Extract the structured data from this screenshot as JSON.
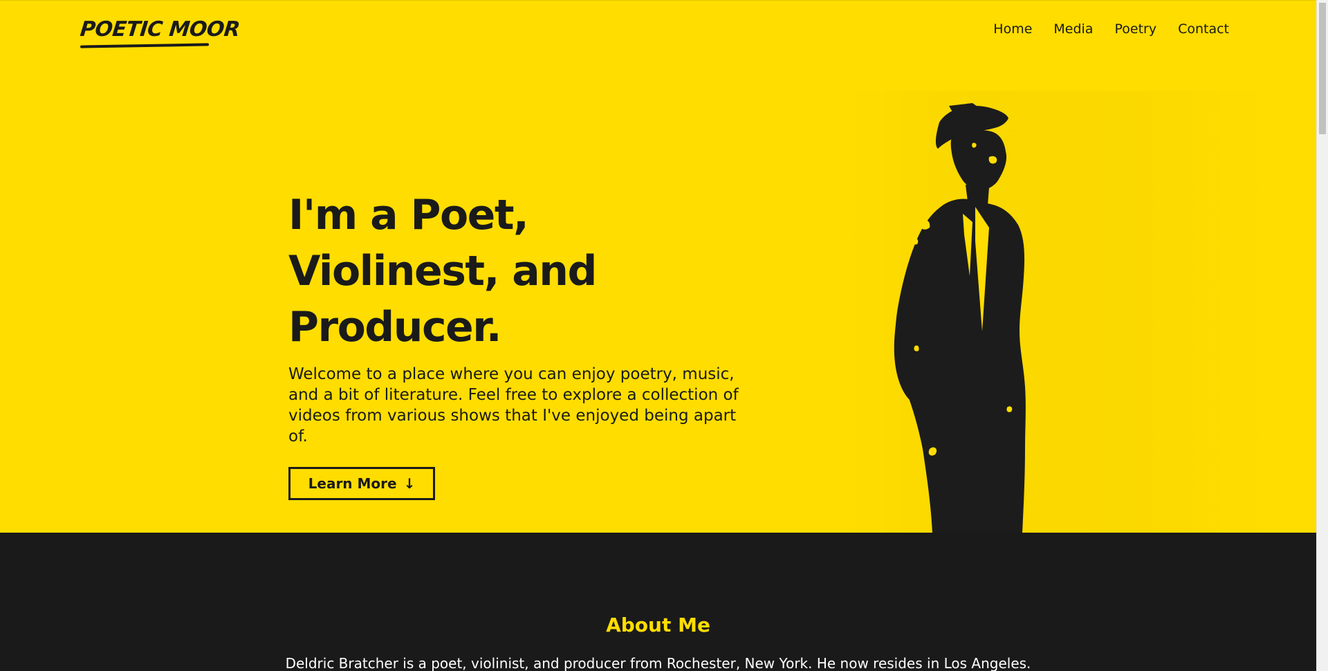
{
  "brand": {
    "logo_text": "POETIC MOOR"
  },
  "nav": {
    "items": [
      "Home",
      "Media",
      "Poetry",
      "Contact"
    ]
  },
  "hero": {
    "title": "I'm a Poet, Violinest, and Producer.",
    "subtitle": "Welcome to a place where you can enjoy poetry, music, and a bit of literature. Feel free to explore a collection of videos from various shows that I've enjoyed being apart of.",
    "button_label": "Learn More",
    "button_icon": "arrow-down-icon",
    "image": "man-in-hat-and-suit-silhouette"
  },
  "about": {
    "title": "About Me",
    "text": "Deldric Bratcher is a poet, violinist, and producer from Rochester, New York. He now resides in Los Angeles."
  },
  "colors": {
    "accent": "#ffdd00",
    "dark": "#1a1a1a",
    "light_text": "#ffffff"
  }
}
